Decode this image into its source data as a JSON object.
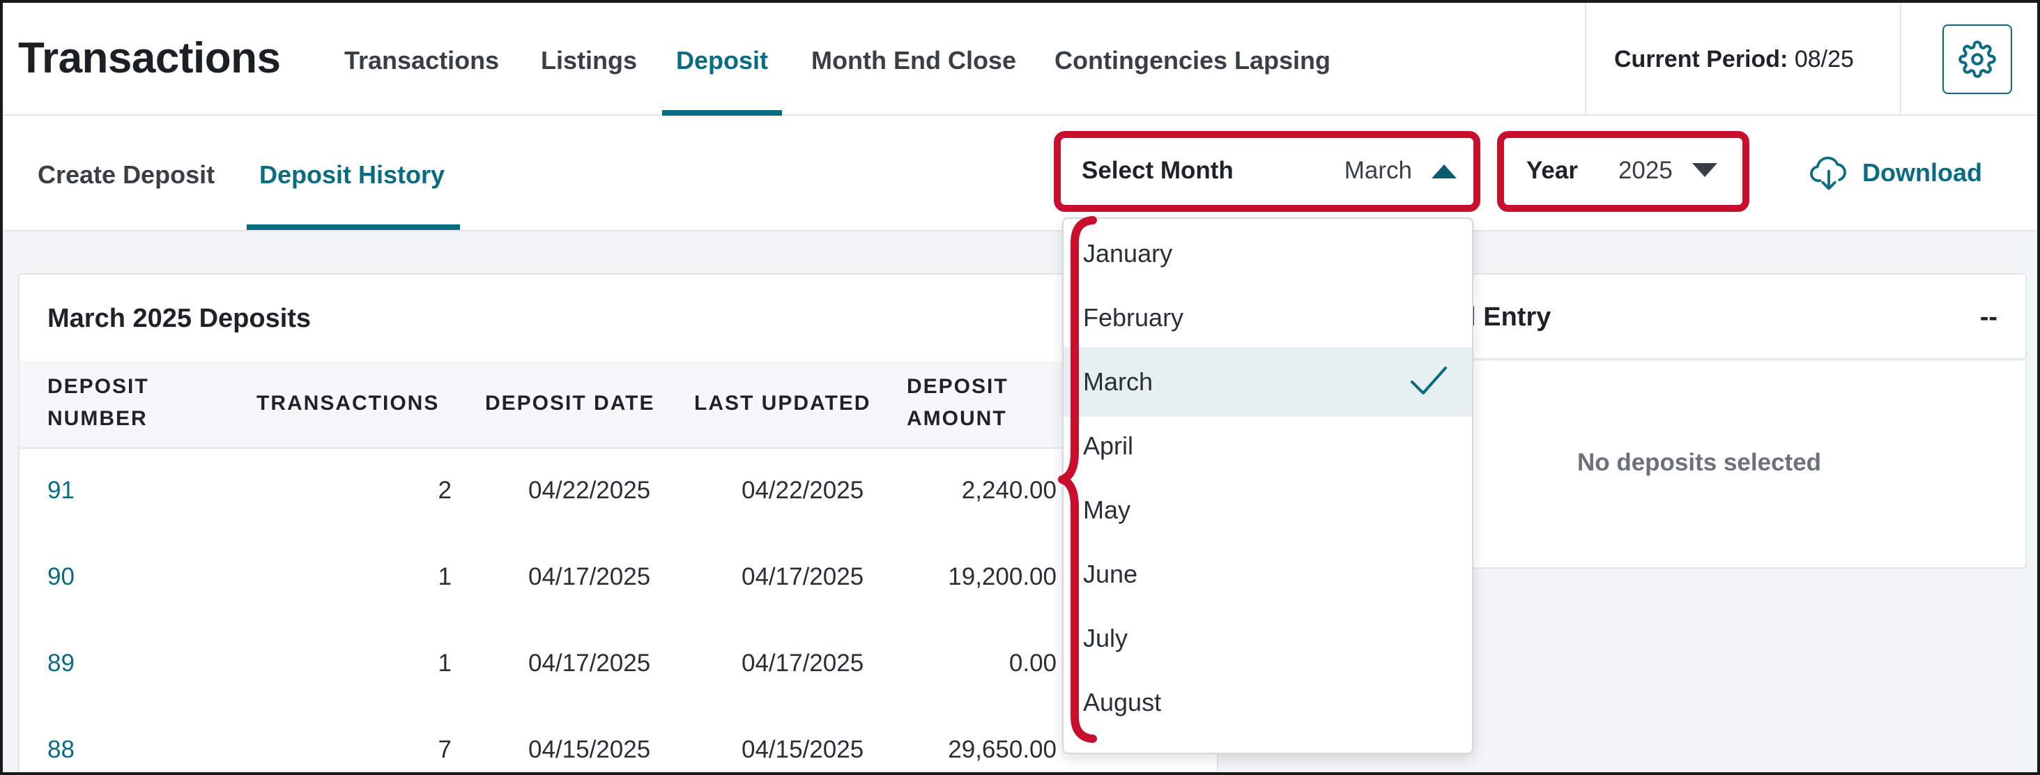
{
  "app": {
    "title": "Transactions"
  },
  "topnav": {
    "tabs": [
      {
        "label": "Transactions"
      },
      {
        "label": "Listings"
      },
      {
        "label": "Deposit",
        "active": true
      },
      {
        "label": "Month End Close"
      },
      {
        "label": "Contingencies Lapsing"
      }
    ],
    "period_label": "Current Period:",
    "period_value": "08/25",
    "settings_icon": "gear-icon"
  },
  "subnav": {
    "tabs": [
      {
        "label": "Create Deposit"
      },
      {
        "label": "Deposit History",
        "active": true
      }
    ],
    "select_month": {
      "label": "Select Month",
      "value": "March"
    },
    "year": {
      "label": "Year",
      "value": "2025"
    },
    "download_label": "Download"
  },
  "deposits": {
    "title": "March 2025 Deposits",
    "columns": {
      "deposit_number": [
        "DEPOSIT",
        "NUMBER"
      ],
      "transactions": "TRANSACTIONS",
      "deposit_date": "DEPOSIT DATE",
      "last_updated": "LAST UPDATED",
      "deposit_amount": [
        "DEPOSIT",
        "AMOUNT"
      ]
    },
    "rows": [
      {
        "number": "91",
        "transactions": "2",
        "deposit_date": "04/22/2025",
        "last_updated": "04/22/2025",
        "amount": "2,240.00"
      },
      {
        "number": "90",
        "transactions": "1",
        "deposit_date": "04/17/2025",
        "last_updated": "04/17/2025",
        "amount": "19,200.00"
      },
      {
        "number": "89",
        "transactions": "1",
        "deposit_date": "04/17/2025",
        "last_updated": "04/17/2025",
        "amount": "0.00"
      },
      {
        "number": "88",
        "transactions": "7",
        "deposit_date": "04/15/2025",
        "last_updated": "04/15/2025",
        "amount": "29,650.00"
      }
    ]
  },
  "journal_panel": {
    "title_visible": "al Entry",
    "dash": "--",
    "empty_message": "No deposits selected"
  },
  "month_dropdown": {
    "options": [
      "January",
      "February",
      "March",
      "April",
      "May",
      "June",
      "July",
      "August"
    ],
    "selected": "March"
  },
  "colors": {
    "accent": "#0b6b80",
    "highlight": "#c8102e",
    "selected_bg": "#e6eff2"
  }
}
